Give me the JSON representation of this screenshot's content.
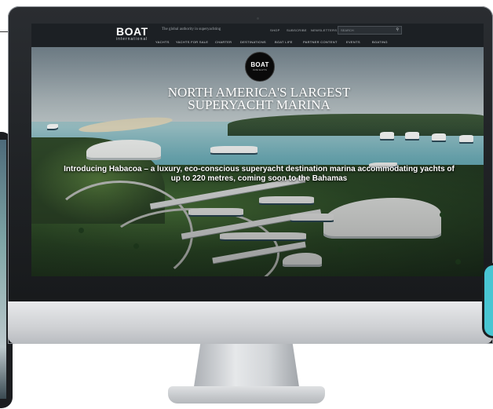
{
  "site": {
    "logo": "BOAT",
    "logo_sub": "international",
    "tagline": "The global authority in superyachting",
    "utility_links": [
      "SHOP",
      "SUBSCRIBE",
      "NEWSLETTERS"
    ],
    "search_placeholder": "SEARCH",
    "menu": [
      "YACHTS",
      "YACHTS FOR SALE",
      "CHARTER",
      "DESTINATIONS",
      "BOAT LIFE",
      "PARTNER CONTENT",
      "EVENTS",
      "BOATING"
    ]
  },
  "hero": {
    "badge_main": "BOAT",
    "badge_sub": "INSIGHTS",
    "headline_line1": "NORTH AMERICA'S LARGEST",
    "headline_line2": "SUPERYACHT MARINA",
    "intro": "Introducing Habacoa – a luxury, eco-conscious superyacht destination marina accommodating yachts of up to 220 metres, coming soon to the Bahamas"
  },
  "colors": {
    "nav_bg": "#1c2024",
    "bezel": "#1b1e21",
    "phone_accent": "#49c6d2"
  }
}
